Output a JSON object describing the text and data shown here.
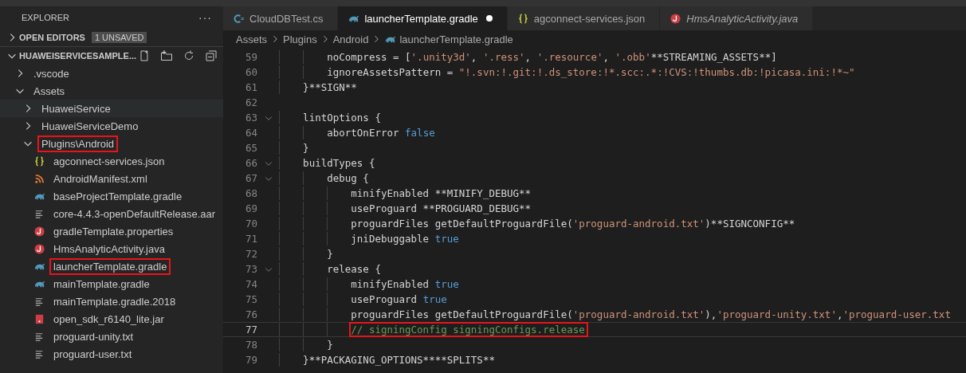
{
  "sidebar": {
    "title": "EXPLORER",
    "more": "···",
    "open_editors": {
      "label": "OPEN EDITORS",
      "expanded": false,
      "badge": "1 UNSAVED"
    },
    "workspace": {
      "label": "HUAWEISERVICESAMPLE...",
      "expanded": true
    },
    "tree": [
      {
        "label": ".vscode",
        "kind": "folder",
        "expanded": false,
        "selected": false,
        "highlighted": false
      },
      {
        "label": "Assets",
        "kind": "folder",
        "expanded": true,
        "selected": false,
        "highlighted": false,
        "children": [
          {
            "label": "HuaweiService",
            "kind": "folder",
            "expanded": false,
            "selected": true,
            "highlighted": false
          },
          {
            "label": "HuaweiServiceDemo",
            "kind": "folder",
            "expanded": false,
            "selected": false,
            "highlighted": false
          },
          {
            "label": "Plugins\\Android",
            "kind": "folder",
            "expanded": true,
            "selected": false,
            "highlighted": true,
            "children": [
              {
                "label": "agconnect-services.json",
                "kind": "json",
                "selected": false,
                "highlighted": false
              },
              {
                "label": "AndroidManifest.xml",
                "kind": "xml",
                "selected": false,
                "highlighted": false
              },
              {
                "label": "baseProjectTemplate.gradle",
                "kind": "gradle",
                "selected": false,
                "highlighted": false
              },
              {
                "label": "core-4.4.3-openDefaultRelease.aar",
                "kind": "text",
                "selected": false,
                "highlighted": false
              },
              {
                "label": "gradleTemplate.properties",
                "kind": "java",
                "selected": false,
                "highlighted": false
              },
              {
                "label": "HmsAnalyticActivity.java",
                "kind": "java",
                "selected": false,
                "highlighted": false
              },
              {
                "label": "launcherTemplate.gradle",
                "kind": "gradle",
                "selected": false,
                "highlighted": true
              },
              {
                "label": "mainTemplate.gradle",
                "kind": "gradle",
                "selected": false,
                "highlighted": false
              },
              {
                "label": "mainTemplate.gradle.2018",
                "kind": "text",
                "selected": false,
                "highlighted": false
              },
              {
                "label": "open_sdk_r6140_lite.jar",
                "kind": "jar",
                "selected": false,
                "highlighted": false
              },
              {
                "label": "proguard-unity.txt",
                "kind": "text",
                "selected": false,
                "highlighted": false
              },
              {
                "label": "proguard-user.txt",
                "kind": "text",
                "selected": false,
                "highlighted": false
              }
            ]
          }
        ]
      }
    ]
  },
  "tabs": [
    {
      "label": "CloudDBTest.cs",
      "kind": "csharp",
      "selected": false,
      "modified": false,
      "preview": false
    },
    {
      "label": "launcherTemplate.gradle",
      "kind": "gradle",
      "selected": true,
      "modified": true,
      "preview": false
    },
    {
      "label": "agconnect-services.json",
      "kind": "json",
      "selected": false,
      "modified": false,
      "preview": false
    },
    {
      "label": "HmsAnalyticActivity.java",
      "kind": "java",
      "selected": false,
      "modified": false,
      "preview": true
    }
  ],
  "breadcrumb": [
    {
      "label": "Assets"
    },
    {
      "label": "Plugins"
    },
    {
      "label": "Android"
    },
    {
      "label": "launcherTemplate.gradle",
      "kind": "gradle"
    }
  ],
  "editor": {
    "lines": [
      {
        "number": "59",
        "fold": false,
        "current": false,
        "highlighted": false,
        "tokens": [
          {
            "kind": "plain",
            "text": "        noCompress = ["
          },
          {
            "kind": "string",
            "text": "'.unity3d'"
          },
          {
            "kind": "plain",
            "text": ", "
          },
          {
            "kind": "string",
            "text": "'.ress'"
          },
          {
            "kind": "plain",
            "text": ", "
          },
          {
            "kind": "string",
            "text": "'.resource'"
          },
          {
            "kind": "plain",
            "text": ", "
          },
          {
            "kind": "string",
            "text": "'.obb'"
          },
          {
            "kind": "plain",
            "text": "**STREAMING_ASSETS**]"
          }
        ]
      },
      {
        "number": "60",
        "fold": false,
        "current": false,
        "highlighted": false,
        "tokens": [
          {
            "kind": "plain",
            "text": "        ignoreAssetsPattern = "
          },
          {
            "kind": "string",
            "text": "\"!.svn:!.git:!.ds_store:!*.scc:.*:!CVS:!thumbs.db:!picasa.ini:!*~\""
          }
        ]
      },
      {
        "number": "61",
        "fold": false,
        "current": false,
        "highlighted": false,
        "tokens": [
          {
            "kind": "plain",
            "text": "    }**SIGN**"
          }
        ]
      },
      {
        "number": "62",
        "fold": false,
        "current": false,
        "highlighted": false
      },
      {
        "number": "63",
        "fold": true,
        "current": false,
        "highlighted": false,
        "tokens": [
          {
            "kind": "plain",
            "text": "    lintOptions {"
          }
        ]
      },
      {
        "number": "64",
        "fold": false,
        "current": false,
        "highlighted": false,
        "tokens": [
          {
            "kind": "plain",
            "text": "        abortOnError "
          },
          {
            "kind": "keyword",
            "text": "false"
          }
        ]
      },
      {
        "number": "65",
        "fold": false,
        "current": false,
        "highlighted": false,
        "tokens": [
          {
            "kind": "plain",
            "text": "    }"
          }
        ]
      },
      {
        "number": "66",
        "fold": true,
        "current": false,
        "highlighted": false,
        "tokens": [
          {
            "kind": "plain",
            "text": "    buildTypes {"
          }
        ]
      },
      {
        "number": "67",
        "fold": true,
        "current": false,
        "highlighted": false,
        "tokens": [
          {
            "kind": "plain",
            "text": "        debug {"
          }
        ]
      },
      {
        "number": "68",
        "fold": false,
        "current": false,
        "highlighted": false,
        "tokens": [
          {
            "kind": "plain",
            "text": "            minifyEnabled **MINIFY_DEBUG**"
          }
        ]
      },
      {
        "number": "69",
        "fold": false,
        "current": false,
        "highlighted": false,
        "tokens": [
          {
            "kind": "plain",
            "text": "            useProguard **PROGUARD_DEBUG**"
          }
        ]
      },
      {
        "number": "70",
        "fold": false,
        "current": false,
        "highlighted": false,
        "tokens": [
          {
            "kind": "plain",
            "text": "            proguardFiles getDefaultProguardFile("
          },
          {
            "kind": "string",
            "text": "'proguard-android.txt'"
          },
          {
            "kind": "plain",
            "text": ")**SIGNCONFIG**"
          }
        ]
      },
      {
        "number": "71",
        "fold": false,
        "current": false,
        "highlighted": false,
        "tokens": [
          {
            "kind": "plain",
            "text": "            jniDebuggable "
          },
          {
            "kind": "keyword",
            "text": "true"
          }
        ]
      },
      {
        "number": "72",
        "fold": false,
        "current": false,
        "highlighted": false,
        "tokens": [
          {
            "kind": "plain",
            "text": "        }"
          }
        ]
      },
      {
        "number": "73",
        "fold": true,
        "current": false,
        "highlighted": false,
        "tokens": [
          {
            "kind": "plain",
            "text": "        release {"
          }
        ]
      },
      {
        "number": "74",
        "fold": false,
        "current": false,
        "highlighted": false,
        "tokens": [
          {
            "kind": "plain",
            "text": "            minifyEnabled "
          },
          {
            "kind": "keyword",
            "text": "true"
          }
        ]
      },
      {
        "number": "75",
        "fold": false,
        "current": false,
        "highlighted": false,
        "tokens": [
          {
            "kind": "plain",
            "text": "            useProguard "
          },
          {
            "kind": "keyword",
            "text": "true"
          }
        ]
      },
      {
        "number": "76",
        "fold": false,
        "current": false,
        "highlighted": false,
        "tokens": [
          {
            "kind": "plain",
            "text": "            proguardFiles getDefaultProguardFile("
          },
          {
            "kind": "string",
            "text": "'proguard-android.txt'"
          },
          {
            "kind": "plain",
            "text": "),"
          },
          {
            "kind": "string",
            "text": "'proguard-unity.txt'"
          },
          {
            "kind": "plain",
            "text": ","
          },
          {
            "kind": "string",
            "text": "'proguard-user.txt"
          }
        ]
      },
      {
        "number": "77",
        "fold": false,
        "current": true,
        "highlighted": true,
        "tokens": [
          {
            "kind": "comment",
            "text": "            // signingConfig signingConfigs.release"
          }
        ]
      },
      {
        "number": "78",
        "fold": false,
        "current": false,
        "highlighted": false,
        "tokens": [
          {
            "kind": "plain",
            "text": "        }"
          }
        ]
      },
      {
        "number": "79",
        "fold": false,
        "current": false,
        "highlighted": false,
        "tokens": [
          {
            "kind": "plain",
            "text": "    }**PACKAGING_OPTIONS****SPLITS**"
          }
        ]
      }
    ]
  }
}
